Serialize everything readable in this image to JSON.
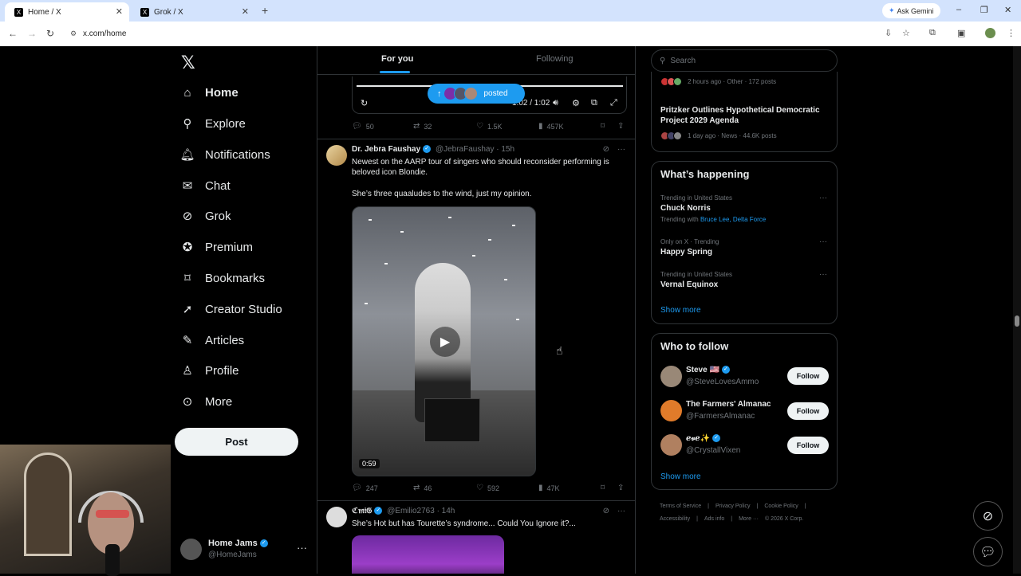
{
  "browser": {
    "tabs": [
      {
        "title": "Home / X",
        "favicon": "X"
      },
      {
        "title": "Grok / X",
        "favicon": "X"
      }
    ],
    "new_tab_icon": "+",
    "ask_gemini": "Ask Gemini",
    "url": "x.com/home",
    "window_controls": [
      "–",
      "❐",
      "✕"
    ]
  },
  "nav": {
    "logo": "𝕏",
    "items": [
      {
        "label": "Home",
        "icon": "home-icon",
        "glyph": "⌂",
        "active": true
      },
      {
        "label": "Explore",
        "icon": "search-icon",
        "glyph": "⚲"
      },
      {
        "label": "Notifications",
        "icon": "bell-icon",
        "glyph": "🔔︎"
      },
      {
        "label": "Chat",
        "icon": "mail-icon",
        "glyph": "✉"
      },
      {
        "label": "Grok",
        "icon": "grok-icon",
        "glyph": "⊘"
      },
      {
        "label": "Premium",
        "icon": "verified-icon",
        "glyph": "✪"
      },
      {
        "label": "Bookmarks",
        "icon": "bookmark-icon",
        "glyph": "⌑"
      },
      {
        "label": "Creator Studio",
        "icon": "rocket-icon",
        "glyph": "➚"
      },
      {
        "label": "Articles",
        "icon": "article-icon",
        "glyph": "✎"
      },
      {
        "label": "Profile",
        "icon": "person-icon",
        "glyph": "♙"
      },
      {
        "label": "More",
        "icon": "more-circle-icon",
        "glyph": "⊙"
      }
    ],
    "post_label": "Post",
    "account": {
      "name": "Home Jams",
      "handle": "@HomeJams",
      "more": "···"
    }
  },
  "feed": {
    "tabs": [
      "For you",
      "Following"
    ],
    "posted_pill": {
      "arrow": "↑",
      "label": "posted"
    },
    "video_player": {
      "time": "1:02 / 1:02"
    },
    "tweet0_actions": {
      "replies": "50",
      "reposts": "32",
      "likes": "1.5K",
      "views": "457K"
    },
    "tweets": [
      {
        "name": "Dr. Jebra Faushay",
        "handle": "@JebraFaushay",
        "time": "· 15h",
        "text1": "Newest on the AARP tour of singers who should reconsider performing is beloved icon Blondie.",
        "text2": "She’s three quaaludes to the wind, just my opinion.",
        "duration": "0:59",
        "actions": {
          "replies": "247",
          "reposts": "46",
          "likes": "592",
          "views": "47K"
        }
      },
      {
        "name": "ℭ𝔪𝔦𝔊",
        "handle": "@Emilio2763",
        "time": "· 14h",
        "text1": "She’s Hot but has Tourette’s syndrome... Could You Ignore it?..."
      }
    ]
  },
  "right": {
    "search_placeholder": "Search",
    "news_top": {
      "meta": "2 hours ago · Other · 172 posts"
    },
    "news_item": {
      "title": "Pritzker Outlines Hypothetical Democratic Project 2029 Agenda",
      "meta": "1 day ago · News · 44.6K posts"
    },
    "whats_happening": {
      "title": "What’s happening",
      "trends": [
        {
          "context": "Trending in United States",
          "name": "Chuck Norris",
          "with_prefix": "Trending with",
          "with": "Bruce Lee, Delta Force"
        },
        {
          "context": "Only on X · Trending",
          "name": "Happy Spring"
        },
        {
          "context": "Trending in United States",
          "name": "Vernal Equinox"
        }
      ],
      "show_more": "Show more"
    },
    "who_to_follow": {
      "title": "Who to follow",
      "accounts": [
        {
          "name": "Steve 🇺🇸",
          "handle": "@SteveLovesAmmo",
          "button": "Follow"
        },
        {
          "name": "The Farmers' Almanac",
          "handle": "@FarmersAlmanac",
          "button": "Follow"
        },
        {
          "name": "ℯ𝓋ℯ✨",
          "handle": "@CrystallVixen",
          "button": "Follow"
        }
      ],
      "show_more": "Show more"
    },
    "footer": [
      "Terms of Service",
      "|",
      "Privacy Policy",
      "|",
      "Cookie Policy",
      "|",
      "Accessibility",
      "|",
      "Ads info",
      "|",
      "More ···",
      "© 2026 X Corp."
    ]
  },
  "colors": {
    "accent": "#1d9bf0",
    "background": "#000000",
    "border": "#2f3336"
  }
}
